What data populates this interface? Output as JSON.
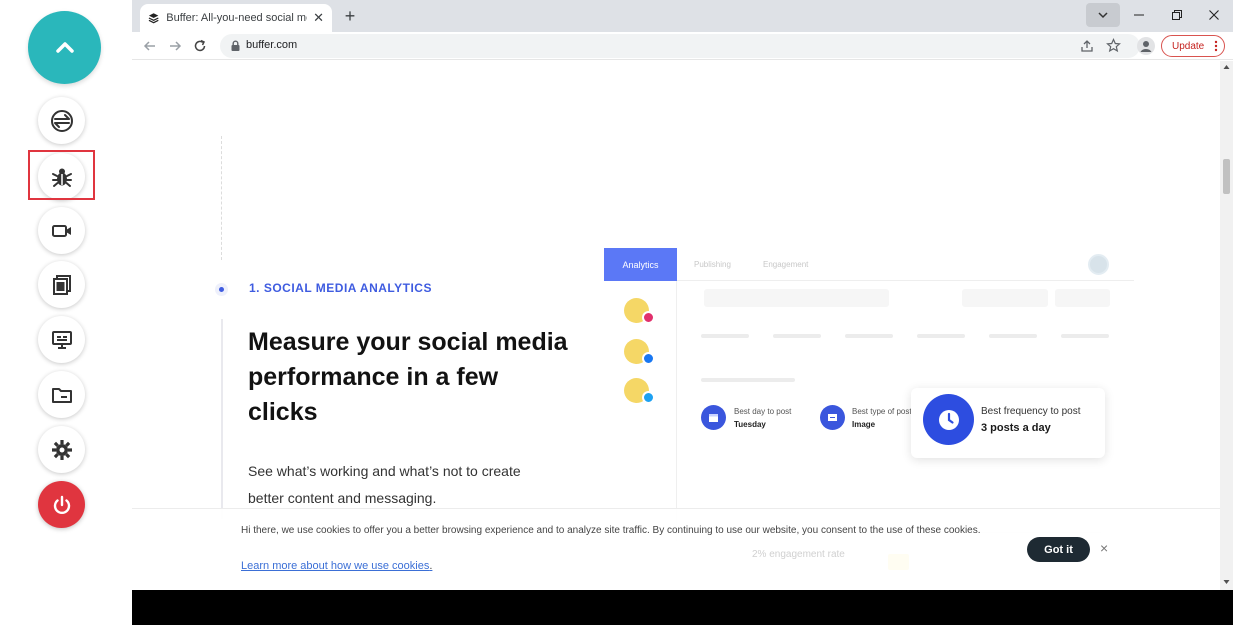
{
  "browser": {
    "tab_title": "Buffer: All-you-need social media toolkit for small businesses",
    "tab_close": "✕",
    "new_tab": "+",
    "url": "buffer.com",
    "update_label": "Update"
  },
  "page": {
    "section_label": "1. SOCIAL MEDIA ANALYTICS",
    "headline": "Measure your social media performance in a few clicks",
    "subcopy": "See what’s working and what’s not to create better content and messaging."
  },
  "mock": {
    "tabs": [
      "Analytics",
      "Publishing",
      "Engagement"
    ],
    "stats": [
      {
        "label": "Best day to post",
        "value": "Tuesday"
      },
      {
        "label": "Best type of post",
        "value": "Image"
      }
    ],
    "frequency": {
      "label": "Best frequency to post",
      "value": "3 posts a day"
    },
    "engagement_ghost": "2% engagement rate"
  },
  "cookie": {
    "text": "Hi there, we use cookies to offer you a better browsing experience and to analyze site traffic. By continuing to use our website, you consent to the use of these cookies.",
    "link": "Learn more about how we use cookies",
    "link_suffix": ".",
    "button": "Got it",
    "close": "×"
  },
  "colors": {
    "fab": "#2ab7bb",
    "power": "#e0353f",
    "brand_blue": "#3f5ce0"
  }
}
